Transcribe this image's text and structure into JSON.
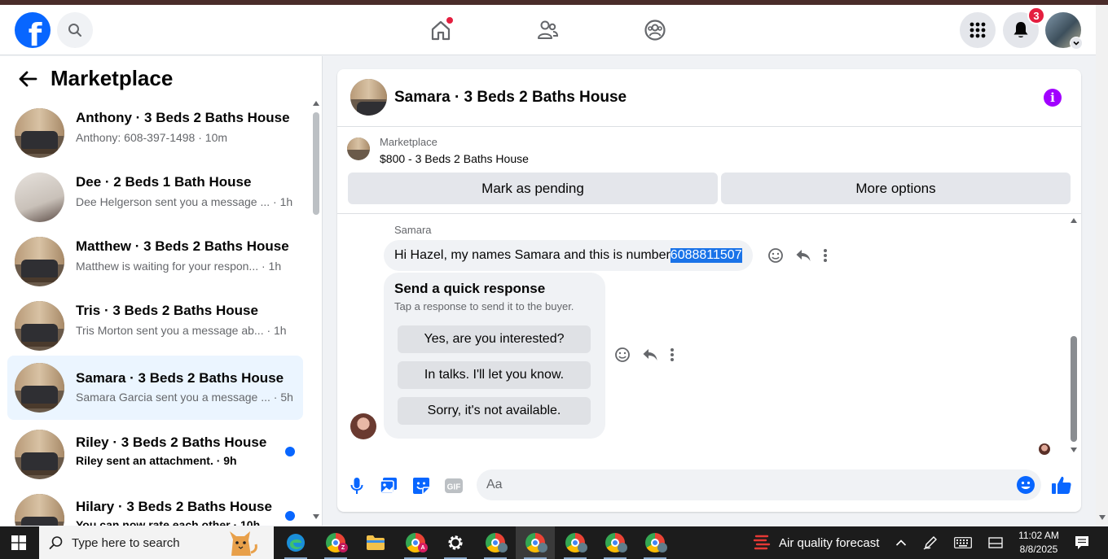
{
  "topbar": {
    "logo_letter": "f",
    "notifications_count": "3"
  },
  "sidebar": {
    "title": "Marketplace",
    "conversations": [
      {
        "name": "Anthony · 3 Beds 2 Baths House",
        "snippet": "Anthony: 608-397-1498 · 10m",
        "unread": false,
        "thumb": "couch"
      },
      {
        "name": "Dee · 2 Beds 1 Bath House",
        "snippet": "Dee Helgerson sent you a message ... · 1h",
        "unread": false,
        "thumb": "wall"
      },
      {
        "name": "Matthew · 3 Beds 2 Baths House",
        "snippet": "Matthew is waiting for your respon... · 1h",
        "unread": false,
        "thumb": "couch"
      },
      {
        "name": "Tris · 3 Beds 2 Baths House",
        "snippet": "Tris Morton sent you a message ab... · 1h",
        "unread": false,
        "thumb": "couch"
      },
      {
        "name": "Samara · 3 Beds 2 Baths House",
        "snippet": "Samara Garcia sent you a message ... · 5h",
        "unread": false,
        "thumb": "couch",
        "active": true
      },
      {
        "name": "Riley · 3 Beds 2 Baths House",
        "snippet": "Riley sent an attachment. · 9h",
        "unread": true,
        "thumb": "couch"
      },
      {
        "name": "Hilary · 3 Beds 2 Baths House",
        "snippet": "You can now rate each other · 10h",
        "unread": true,
        "thumb": "couch"
      }
    ]
  },
  "chat": {
    "title": "Samara · 3 Beds 2 Baths House",
    "listing_category": "Marketplace",
    "listing_price": "$800 - 3 Beds 2 Baths House",
    "mark_pending_label": "Mark as pending",
    "more_options_label": "More options",
    "sender_name": "Samara",
    "message_text": "Hi Hazel, my names Samara and this is number ",
    "message_highlight": "6088811507",
    "quick_response": {
      "title": "Send a quick response",
      "subtitle": "Tap a response to send it to the buyer.",
      "options": [
        "Yes, are you interested?",
        "In talks. I'll let you know.",
        "Sorry, it's not available."
      ]
    },
    "composer_placeholder": "Aa"
  },
  "taskbar": {
    "search_placeholder": "Type here to search",
    "weather_label": "Air quality forecast",
    "time": "11:02 AM",
    "date": "8/8/2025"
  },
  "colors": {
    "facebook_blue": "#0866ff",
    "notification_red": "#e41e3f",
    "info_purple": "#a100ff",
    "active_row": "#ebf5ff",
    "text_highlight": "#1a73e8"
  }
}
